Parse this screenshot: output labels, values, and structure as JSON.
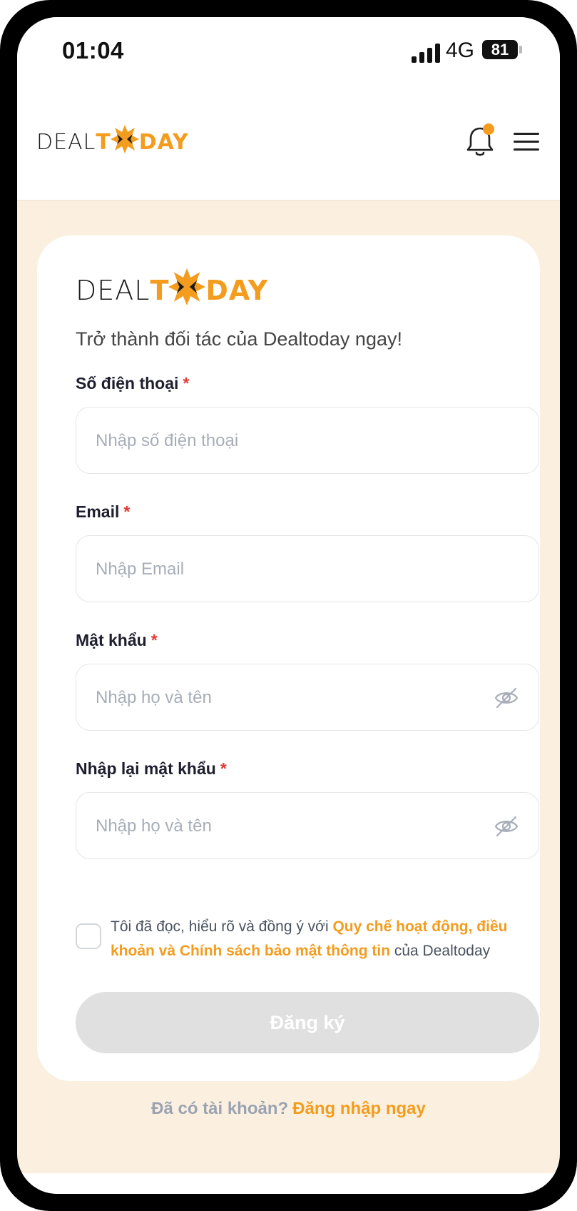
{
  "status_bar": {
    "time": "01:04",
    "network": "4G",
    "battery": "81"
  },
  "header": {
    "logo_left": "DEAL",
    "logo_t": "T",
    "logo_right": "DAY"
  },
  "card": {
    "logo_left": "DEAL",
    "logo_t": "T",
    "logo_right": "DAY",
    "subtitle": "Trở thành đối tác của Dealtoday ngay!"
  },
  "form": {
    "phone": {
      "label": "Số điện thoại",
      "required": "*",
      "placeholder": "Nhập số điện thoại",
      "value": ""
    },
    "email": {
      "label": "Email",
      "required": "*",
      "placeholder": "Nhập Email",
      "value": ""
    },
    "password": {
      "label": "Mật khẩu",
      "required": "*",
      "placeholder": "Nhập họ và tên",
      "value": ""
    },
    "confirm_password": {
      "label": "Nhập lại mật khẩu",
      "required": "*",
      "placeholder": "Nhập họ và tên",
      "value": ""
    }
  },
  "terms": {
    "prefix": "Tôi đã đọc, hiểu rõ và đồng ý với ",
    "link": "Quy chế hoạt động, điều khoản và Chính sách bảo mật thông tin",
    "suffix": " của Dealtoday",
    "checked": false
  },
  "submit_label": "Đăng ký",
  "login": {
    "prompt": "Đã có tài khoản?",
    "link": "Đăng nhập ngay"
  },
  "colors": {
    "accent": "#f39c1e",
    "background": "#fbf0e0",
    "required": "#e53935",
    "button_disabled": "#e0e0e0"
  },
  "icons": [
    "signal-icon",
    "battery-icon",
    "bell-icon",
    "menu-icon",
    "eye-off-icon",
    "logo-burst-icon"
  ]
}
